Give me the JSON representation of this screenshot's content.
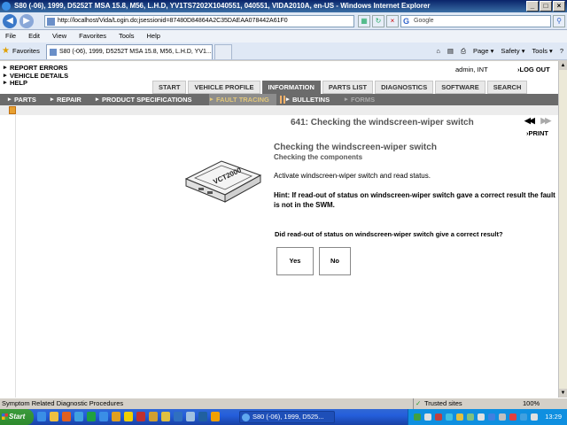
{
  "window": {
    "title": "S80 (-06), 1999, D5252T MSA 15.8, M56, L.H.D, YV1TS7202X1040551, 040551, VIDA2010A, en-US - Windows Internet Explorer",
    "controls": [
      "_",
      "□",
      "×"
    ]
  },
  "browser": {
    "url": "http://localhost/Vida/Login.do;jsessionid=87480D84864A2C35DAEAA078442A61F0",
    "search_placeholder": "Google",
    "menu": [
      "File",
      "Edit",
      "View",
      "Favorites",
      "Tools",
      "Help"
    ],
    "favorites_label": "Favorites",
    "tab_title": "S80 (-06), 1999, D5252T MSA 15.8, M56, L.H.D, YV1...",
    "commands": [
      "Page ▾",
      "Safety ▾",
      "Tools ▾"
    ],
    "status_text": "Symptom Related Diagnostic Procedures",
    "zone": "Trusted sites",
    "zoom": "100%"
  },
  "vida": {
    "top_links": [
      "REPORT ERRORS",
      "VEHICLE DETAILS",
      "HELP"
    ],
    "user": "admin, INT",
    "logout": "LOG OUT",
    "main_tabs": [
      "START",
      "VEHICLE PROFILE",
      "INFORMATION",
      "PARTS LIST",
      "DIAGNOSTICS",
      "SOFTWARE",
      "SEARCH"
    ],
    "active_main_tab": "INFORMATION",
    "sub_tabs": [
      "PARTS",
      "REPAIR",
      "PRODUCT SPECIFICATIONS",
      "FAULT TRACING",
      "BULLETINS",
      "FORMS"
    ],
    "active_sub_tab": "FAULT TRACING"
  },
  "page": {
    "heading": "641: Checking the windscreen-wiper switch",
    "print": "PRINT",
    "device_label": "VCT2000",
    "title": "Checking the windscreen-wiper switch",
    "subtitle": "Checking the components",
    "instruction": "Activate windscreen-wiper switch and read status.",
    "hint": "Hint: If read-out of status on windscreen-wiper switch gave a correct result the fault is not in the SWM.",
    "question": "Did read-out of status on windscreen-wiper switch give a correct result?",
    "yes": "Yes",
    "no": "No"
  },
  "taskbar": {
    "start": "Start",
    "task": "S80 (-06), 1999, D525...",
    "clock": "13:29"
  }
}
